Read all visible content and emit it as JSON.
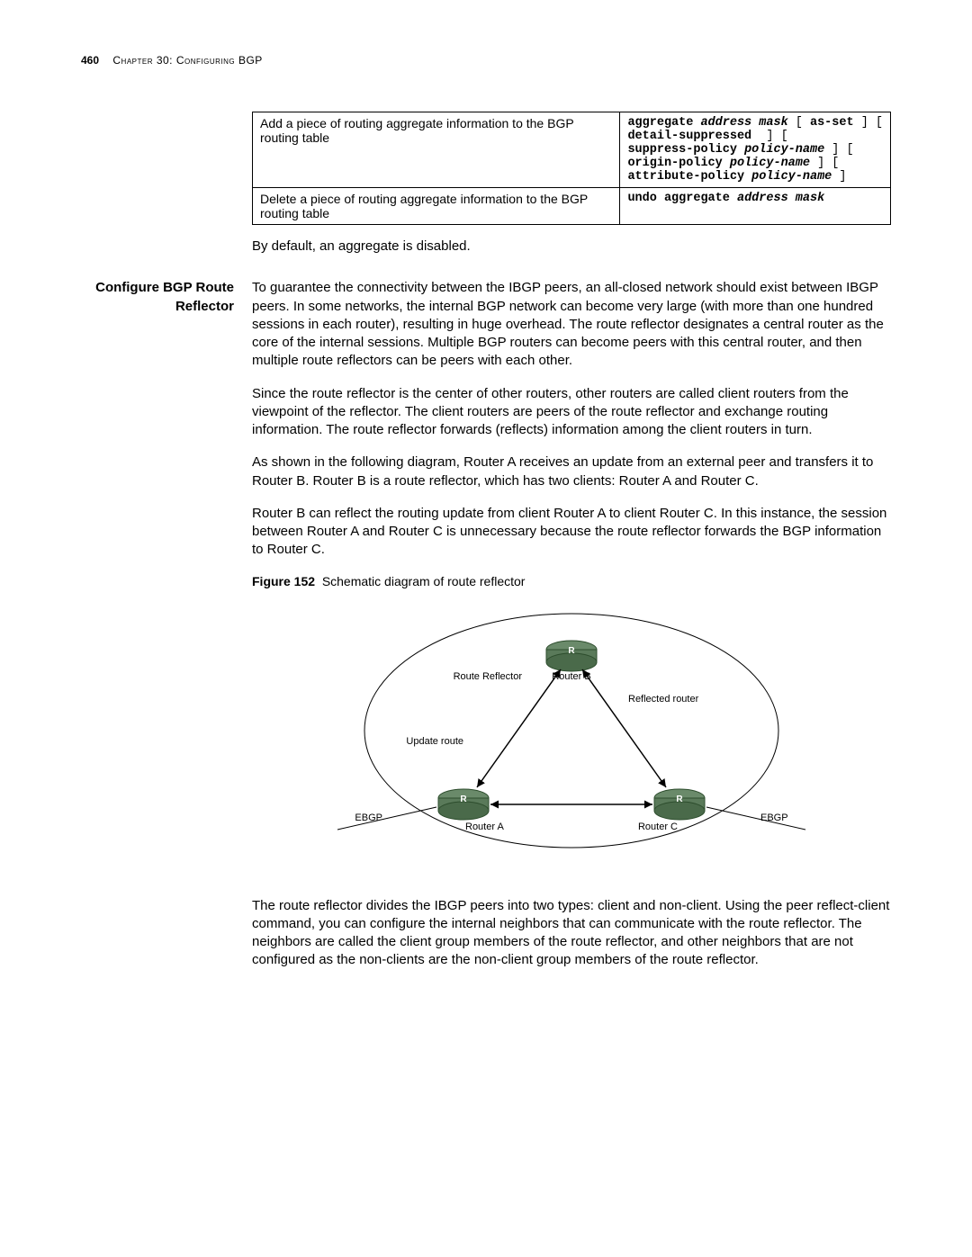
{
  "header": {
    "page_number": "460",
    "chapter": "Chapter 30: Configuring BGP"
  },
  "table": {
    "rows": [
      {
        "desc": "Add a piece of routing aggregate information to the BGP routing table",
        "code_parts": [
          {
            "t": "aggregate ",
            "s": "b"
          },
          {
            "t": "address mask",
            "s": "i"
          },
          {
            "t": " [ ",
            "s": ""
          },
          {
            "t": "as-set",
            "s": "b"
          },
          {
            "t": " ] [\n",
            "s": ""
          },
          {
            "t": "detail-suppressed",
            "s": "b"
          },
          {
            "t": "  ] [\n",
            "s": ""
          },
          {
            "t": "suppress-policy ",
            "s": "b"
          },
          {
            "t": "policy-name",
            "s": "i"
          },
          {
            "t": " ] [\n",
            "s": ""
          },
          {
            "t": "origin-policy ",
            "s": "b"
          },
          {
            "t": "policy-name",
            "s": "i"
          },
          {
            "t": " ] [\n",
            "s": ""
          },
          {
            "t": "attribute-policy ",
            "s": "b"
          },
          {
            "t": "policy-name",
            "s": "i"
          },
          {
            "t": " ]",
            "s": ""
          }
        ]
      },
      {
        "desc": "Delete a piece of routing aggregate information to the BGP routing table",
        "code_parts": [
          {
            "t": "undo aggregate ",
            "s": "b"
          },
          {
            "t": "address mask",
            "s": "i"
          }
        ]
      }
    ]
  },
  "para_default": "By default, an aggregate is disabled.",
  "section": {
    "heading": "Configure BGP Route Reflector",
    "p1": "To guarantee the connectivity between the IBGP peers, an all-closed network should exist between IBGP peers. In some networks, the internal BGP network can become very large (with more than one hundred sessions in each router), resulting in huge overhead. The route reflector designates a central router as the core of the internal sessions. Multiple BGP routers can become peers with this central router, and then multiple route reflectors can be peers with each other.",
    "p2": "Since the route reflector is the center of other routers, other routers are called client routers from the viewpoint of the reflector. The client routers are peers of the route reflector and exchange routing information. The route reflector forwards (reflects) information among the client routers in turn.",
    "p3": "As shown in the following diagram, Router A receives an update from an external peer and transfers it to Router B. Router B is a route reflector, which has two clients: Router A and Router C.",
    "p4": "Router B can reflect the routing update from client Router A to client Router C. In this instance, the session between Router A and Router C is unnecessary because the route reflector forwards the BGP information to Router C.",
    "figure": {
      "label": "Figure 152",
      "caption": "Schematic diagram of route reflector",
      "labels": {
        "route_reflector": "Route Reflector",
        "router_b": "Router B",
        "reflected_router": "Reflected router",
        "update_route": "Update route",
        "ebgp_left": "EBGP",
        "ebgp_right": "EBGP",
        "router_a": "Router A",
        "router_c": "Router C"
      }
    },
    "p5": "The route reflector divides the IBGP peers into two types: client and non-client. Using the peer reflect-client command, you can configure the internal neighbors that can communicate with the route reflector. The neighbors are called the client group members of the route reflector, and other neighbors that are not configured as the non-clients are the non-client group members of the route reflector."
  }
}
